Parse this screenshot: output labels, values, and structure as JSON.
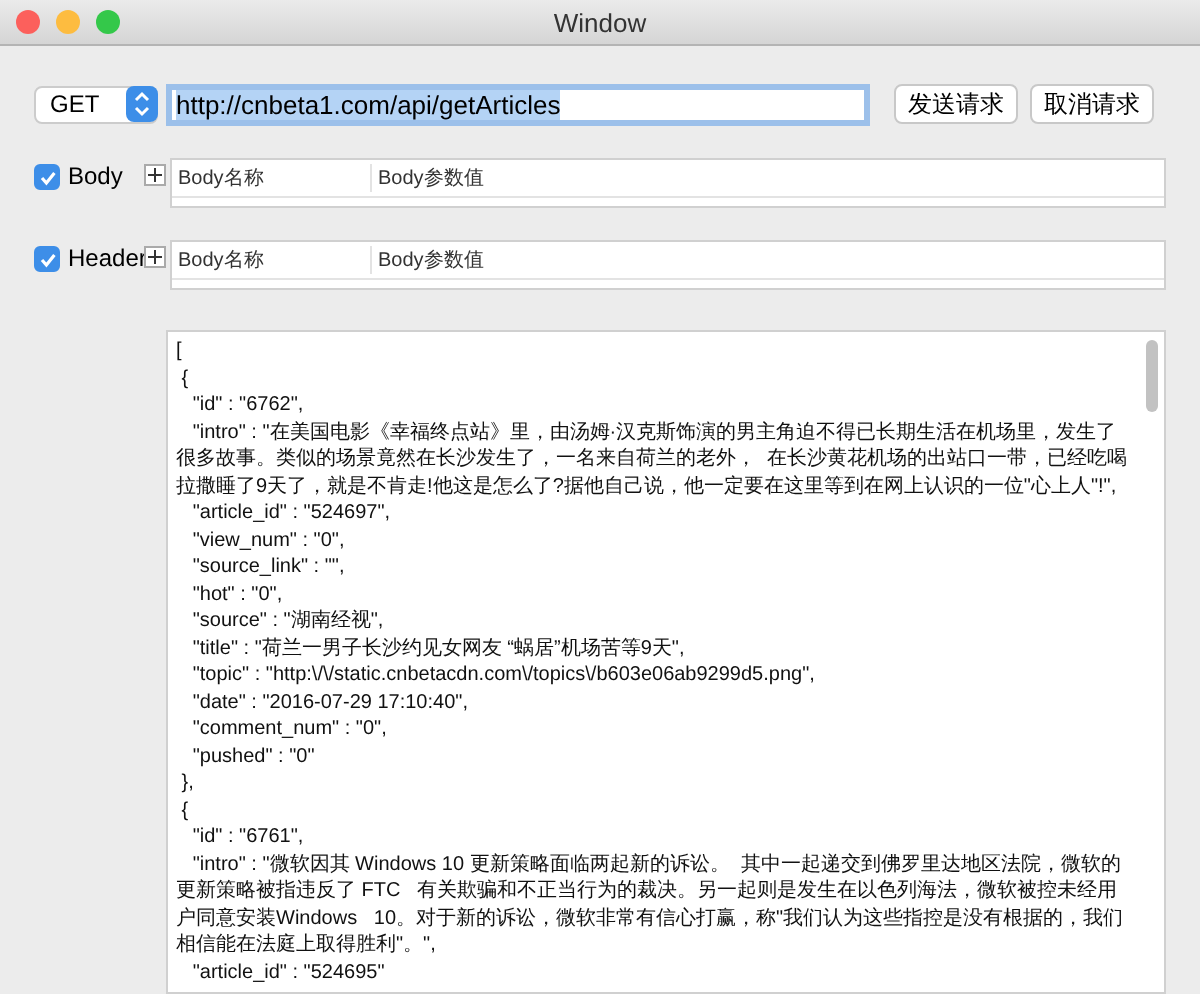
{
  "window": {
    "title": "Window"
  },
  "request": {
    "method": "GET",
    "url": "http://cnbeta1.com/api/getArticles",
    "buttons": [
      "发送请求",
      "取消请求"
    ]
  },
  "sections": [
    {
      "label": "Body",
      "checked": true,
      "columns": [
        "Body名称",
        "Body参数值"
      ]
    },
    {
      "label": "Header",
      "checked": true,
      "columns": [
        "Body名称",
        "Body参数值"
      ]
    }
  ],
  "response": {
    "lines": [
      "[",
      " {",
      "   \"id\" : \"6762\",",
      "   \"intro\" : \"在美国电影《幸福终点站》里，由汤姆·汉克斯饰演的男主角迫不得已长期生活在机场里，发生了很多故事。类似的场景竟然在长沙发生了，一名来自荷兰的老外，  在长沙黄花机场的出站口一带，已经吃喝拉撒睡了9天了，就是不肯走!他这是怎么了?据他自己说，他一定要在这里等到在网上认识的一位\"心上人\"!\",",
      "   \"article_id\" : \"524697\",",
      "   \"view_num\" : \"0\",",
      "   \"source_link\" : \"\",",
      "   \"hot\" : \"0\",",
      "   \"source\" : \"湖南经视\",",
      "   \"title\" : \"荷兰一男子长沙约见女网友 “蜗居”机场苦等9天\",",
      "   \"topic\" : \"http:\\/\\/static.cnbetacdn.com\\/topics\\/b603e06ab9299d5.png\",",
      "   \"date\" : \"2016-07-29 17:10:40\",",
      "   \"comment_num\" : \"0\",",
      "   \"pushed\" : \"0\"",
      " },",
      " {",
      "   \"id\" : \"6761\",",
      "   \"intro\" : \"微软因其 Windows 10 更新策略面临两起新的诉讼。  其中一起递交到佛罗里达地区法院，微软的更新策略被指违反了 FTC   有关欺骗和不正当行为的裁决。另一起则是发生在以色列海法，微软被控未经用户同意安装Windows   10。对于新的诉讼，微软非常有信心打赢，称\"我们认为这些指控是没有根据的，我们相信能在法庭上取得胜利\"。\",",
      "   \"article_id\" : \"524695\""
    ]
  }
}
